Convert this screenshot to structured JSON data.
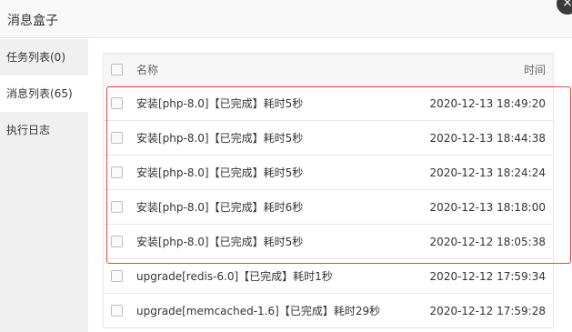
{
  "dialog": {
    "title": "消息盒子",
    "close_symbol": "×"
  },
  "sidebar": {
    "items": [
      {
        "label": "任务列表(0)",
        "active": false
      },
      {
        "label": "消息列表(65)",
        "active": true
      },
      {
        "label": "执行日志",
        "active": false
      }
    ]
  },
  "table": {
    "headers": {
      "name": "名称",
      "time": "时间"
    },
    "rows": [
      {
        "name": "安装[php-8.0]【已完成】耗时5秒",
        "time": "2020-12-13 18:49:20"
      },
      {
        "name": "安装[php-8.0]【已完成】耗时5秒",
        "time": "2020-12-13 18:44:38"
      },
      {
        "name": "安装[php-8.0]【已完成】耗时5秒",
        "time": "2020-12-13 18:24:24"
      },
      {
        "name": "安装[php-8.0]【已完成】耗时6秒",
        "time": "2020-12-13 18:18:00"
      },
      {
        "name": "安装[php-8.0]【已完成】耗时5秒",
        "time": "2020-12-12 18:05:38"
      },
      {
        "name": "upgrade[redis-6.0]【已完成】耗时1秒",
        "time": "2020-12-12 17:59:34"
      },
      {
        "name": "upgrade[memcached-1.6]【已完成】耗时29秒",
        "time": "2020-12-12 17:59:28"
      }
    ]
  },
  "colors": {
    "highlight_border": "#e24b43",
    "sidebar_bg": "#f0f0f0",
    "header_bg": "#f6f6f6"
  }
}
